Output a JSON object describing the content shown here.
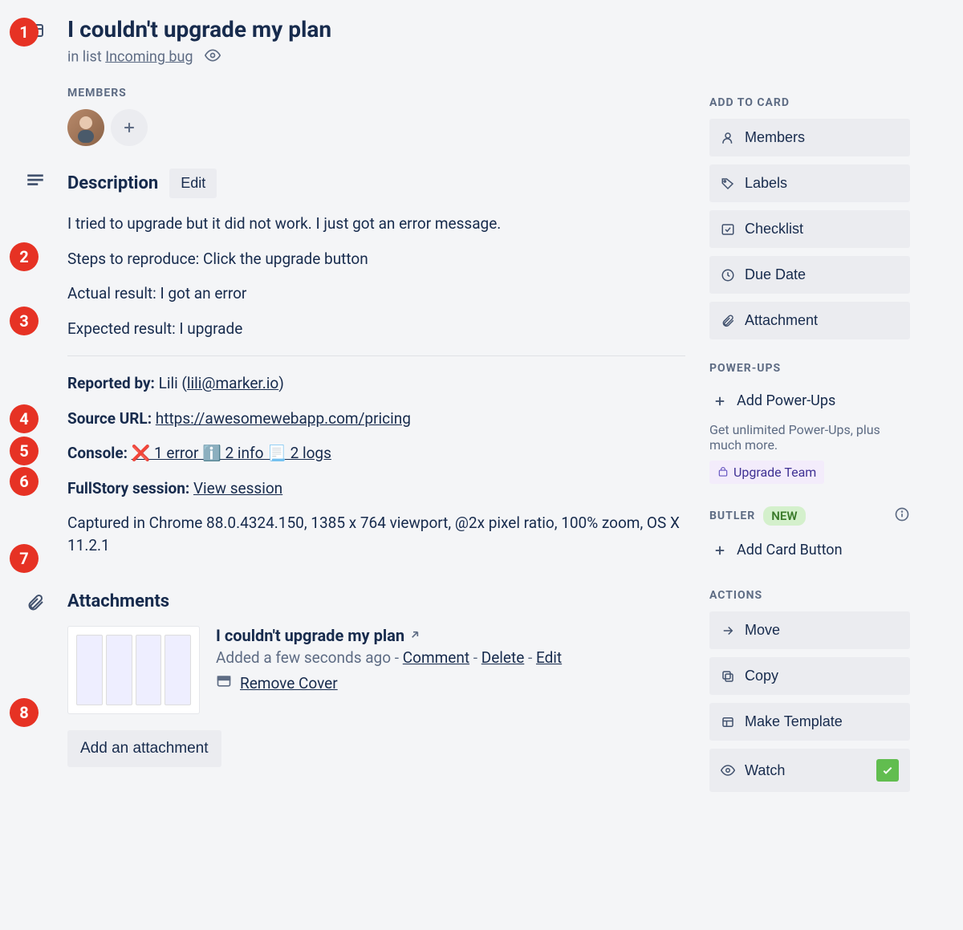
{
  "header": {
    "title": "I couldn't upgrade my plan",
    "in_list_prefix": "in list",
    "list_name": "Incoming bug"
  },
  "members": {
    "label": "MEMBERS"
  },
  "description": {
    "heading": "Description",
    "edit_label": "Edit",
    "body_lines": [
      "I tried to upgrade but it did not work. I just got an error message.",
      "Steps to reproduce: Click the upgrade button",
      "Actual result: I got an error",
      "Expected result: I upgrade"
    ],
    "reported_label": "Reported by:",
    "reporter_name": "Lili",
    "reporter_email": "lili@marker.io",
    "source_label": "Source URL:",
    "source_url": "https://awesomewebapp.com/pricing",
    "console_label": "Console:",
    "console_summary": "❌ 1 error ℹ️ 2 info 📃 2 logs",
    "fullstory_label": "FullStory session:",
    "fullstory_link": "View session",
    "captured_info": "Captured in Chrome 88.0.4324.150, 1385 x 764 viewport, @2x pixel ratio, 100% zoom, OS X 11.2.1"
  },
  "attachments": {
    "heading": "Attachments",
    "items": [
      {
        "title": "I couldn't upgrade my plan",
        "added": "Added a few seconds ago",
        "comment": "Comment",
        "delete": "Delete",
        "edit": "Edit",
        "remove_cover": "Remove Cover"
      }
    ],
    "add_label": "Add an attachment"
  },
  "sidebar": {
    "add_to_card": {
      "label": "ADD TO CARD",
      "buttons": {
        "members": "Members",
        "labels": "Labels",
        "checklist": "Checklist",
        "due_date": "Due Date",
        "attachment": "Attachment"
      }
    },
    "powerups": {
      "label": "POWER-UPS",
      "add": "Add Power-Ups",
      "note": "Get unlimited Power-Ups, plus much more.",
      "upgrade": "Upgrade Team"
    },
    "butler": {
      "label": "BUTLER",
      "new_badge": "NEW",
      "add": "Add Card Button"
    },
    "actions": {
      "label": "ACTIONS",
      "move": "Move",
      "copy": "Copy",
      "template": "Make Template",
      "watch": "Watch"
    }
  },
  "annotations": [
    "1",
    "2",
    "3",
    "4",
    "5",
    "6",
    "7",
    "8"
  ]
}
